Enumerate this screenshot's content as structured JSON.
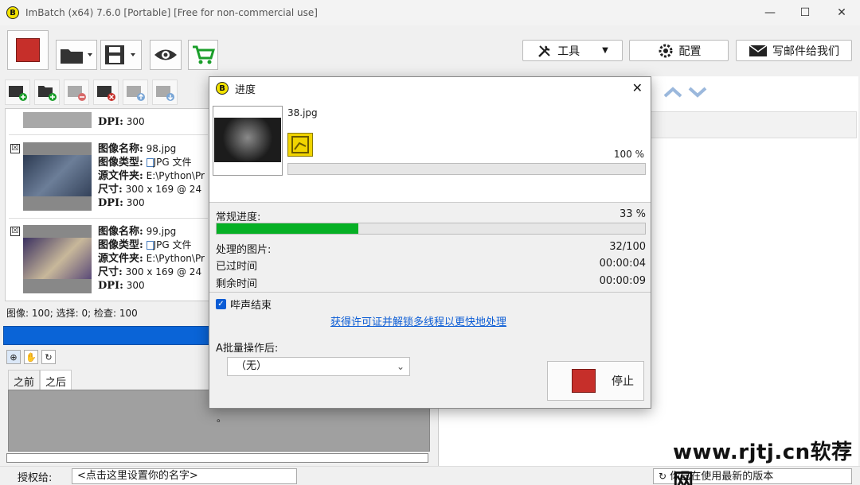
{
  "window": {
    "title": "ImBatch (x64) 7.6.0 [Portable] [Free for non-commercial use]",
    "logo_letter": "B",
    "minimize": "—",
    "maximize": "☐",
    "close": "✕"
  },
  "toolbar": {
    "tools_label": "工具",
    "config_label": "配置",
    "email_label": "写邮件给我们"
  },
  "image_list": [
    {
      "dpi_label": "DPI:",
      "dpi": "300"
    },
    {
      "checkbox": "☒",
      "name_label": "图像名称:",
      "name": "98.jpg",
      "type_label": "图像类型:",
      "type": "JPG 文件",
      "folder_label": "源文件夹:",
      "folder": "E:\\Python\\Pr",
      "size_label": "尺寸:",
      "size": "300 x 169 @ 24",
      "dpi_label": "DPI:",
      "dpi": "300"
    },
    {
      "checkbox": "☒",
      "name_label": "图像名称:",
      "name": "99.jpg",
      "type_label": "图像类型:",
      "type": "JPG 文件",
      "folder_label": "源文件夹:",
      "folder": "E:\\Python\\Pr",
      "size_label": "尺寸:",
      "size": "300 x 169 @ 24",
      "dpi_label": "DPI:",
      "dpi": "300"
    }
  ],
  "status": {
    "summary": "图像: 100; 选择: 0; 检查: 100"
  },
  "preview_tabs": {
    "before": "之前",
    "after": "之后"
  },
  "bottom": {
    "license_label": "授权给:",
    "name_placeholder": "<点击这里设置你的名字>",
    "version_text": "你已在使用最新的版本"
  },
  "watermark": "www.rjtj.cn软荐网",
  "dialog": {
    "title": "进度",
    "close": "✕",
    "current_file": "38.jpg",
    "file_percent": "100 %",
    "file_progress": 1.0,
    "overall_label": "常规进度:",
    "overall_percent": "33 %",
    "overall_progress": 0.33,
    "processed_label": "处理的图片:",
    "processed_value": "32/100",
    "elapsed_label": "已过时间",
    "elapsed_value": "00:00:04",
    "remaining_label": "剩余时间",
    "remaining_value": "00:00:09",
    "beep_label": "哔声结束",
    "beep_check": "✓",
    "license_link": "获得许可证并解锁多线程以更快地处理",
    "after_label": "A批量操作后:",
    "after_option": "（无）",
    "dropdown_arrow": "⌄",
    "stop_label": "停止"
  },
  "stray_dot": "。",
  "colors": {
    "accent_blue": "#0a64d7",
    "progress_green": "#06b025",
    "stop_red": "#c62f2a",
    "link_blue": "#0b5cd5"
  }
}
